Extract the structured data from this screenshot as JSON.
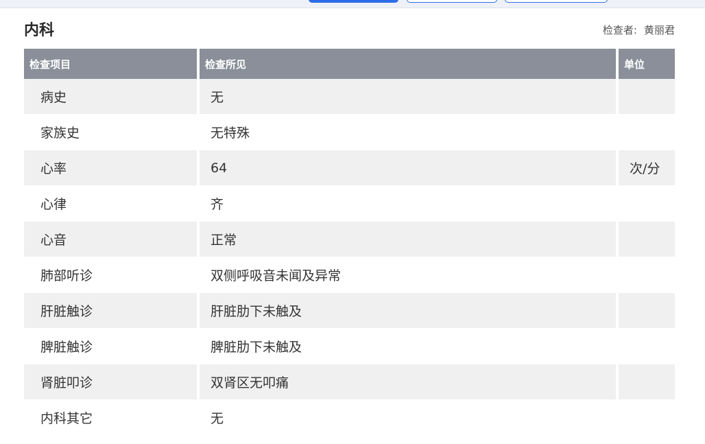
{
  "section": {
    "title": "内科",
    "examiner_label": "检查者:",
    "examiner_name": "黄丽君"
  },
  "table": {
    "columns": [
      "检查项目",
      "检查所见",
      "单位"
    ],
    "rows": [
      {
        "item": "病史",
        "finding": "无",
        "unit": ""
      },
      {
        "item": "家族史",
        "finding": "无特殊",
        "unit": ""
      },
      {
        "item": "心率",
        "finding": "64",
        "unit": "次/分"
      },
      {
        "item": "心律",
        "finding": "齐",
        "unit": ""
      },
      {
        "item": "心音",
        "finding": "正常",
        "unit": ""
      },
      {
        "item": "肺部听诊",
        "finding": "双侧呼吸音未闻及异常",
        "unit": ""
      },
      {
        "item": "肝脏触诊",
        "finding": "肝脏肋下未触及",
        "unit": ""
      },
      {
        "item": "脾脏触诊",
        "finding": "脾脏肋下未触及",
        "unit": ""
      },
      {
        "item": "肾脏叩诊",
        "finding": "双肾区无叩痛",
        "unit": ""
      },
      {
        "item": "内科其它",
        "finding": "无",
        "unit": ""
      }
    ]
  },
  "colors": {
    "header_bg": "#8a8f99",
    "row_shade": "#f0f0f0",
    "accent": "#2d6ee8"
  }
}
